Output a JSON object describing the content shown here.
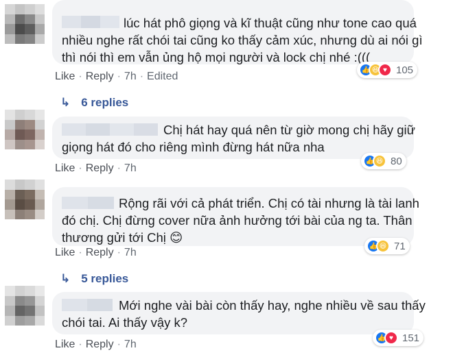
{
  "comments": [
    {
      "lines": [
        "lúc hát phô giọng và kĩ thuật cũng như tone cao quá",
        "nhiều nghe rất chói tai cũng ko thấy cảm xúc, nhưng dù ai nói gì",
        "thì nói thì em vẫn ủng hộ mọi người và lock chị nhé :((("
      ],
      "actions": {
        "like": "Like",
        "reply": "Reply",
        "time": "7h",
        "edited": "Edited"
      },
      "reaction_count": "105",
      "reactions": [
        "like-icon",
        "haha-icon",
        "love-icon"
      ],
      "replies_label": "6 replies"
    },
    {
      "lines": [
        "Chị hát hay quá nên từ giờ mong chị hãy giữ",
        "giọng hát đó cho riêng mình đừng hát nữa nha"
      ],
      "actions": {
        "like": "Like",
        "reply": "Reply",
        "time": "7h"
      },
      "reaction_count": "80",
      "reactions": [
        "like-icon",
        "haha-icon"
      ]
    },
    {
      "lines": [
        "Rộng rãi với cả phát triển. Chị có tài nhưng là tài lanh",
        "đó chị. Chị đừng cover nữa ảnh hưởng tới bài của ng ta. Thân",
        "thương gửi tới Chị"
      ],
      "emoji": "😊",
      "actions": {
        "like": "Like",
        "reply": "Reply",
        "time": "7h"
      },
      "reaction_count": "71",
      "reactions": [
        "like-icon",
        "haha-icon"
      ],
      "replies_label": "5 replies"
    },
    {
      "lines": [
        "Mới nghe vài bài còn thấy hay, nghe nhiều về sau thấy",
        "chói tai. Ai thấy vậy k?"
      ],
      "actions": {
        "like": "Like",
        "reply": "Reply",
        "time": "7h"
      },
      "reaction_count": "151",
      "reactions": [
        "like-icon",
        "love-icon"
      ]
    }
  ],
  "colors": {
    "bubble": "#f2f3f5",
    "link": "#385898",
    "meta": "#606770",
    "like": "#1877f2",
    "haha": "#f7c33b",
    "love": "#f0284a"
  }
}
